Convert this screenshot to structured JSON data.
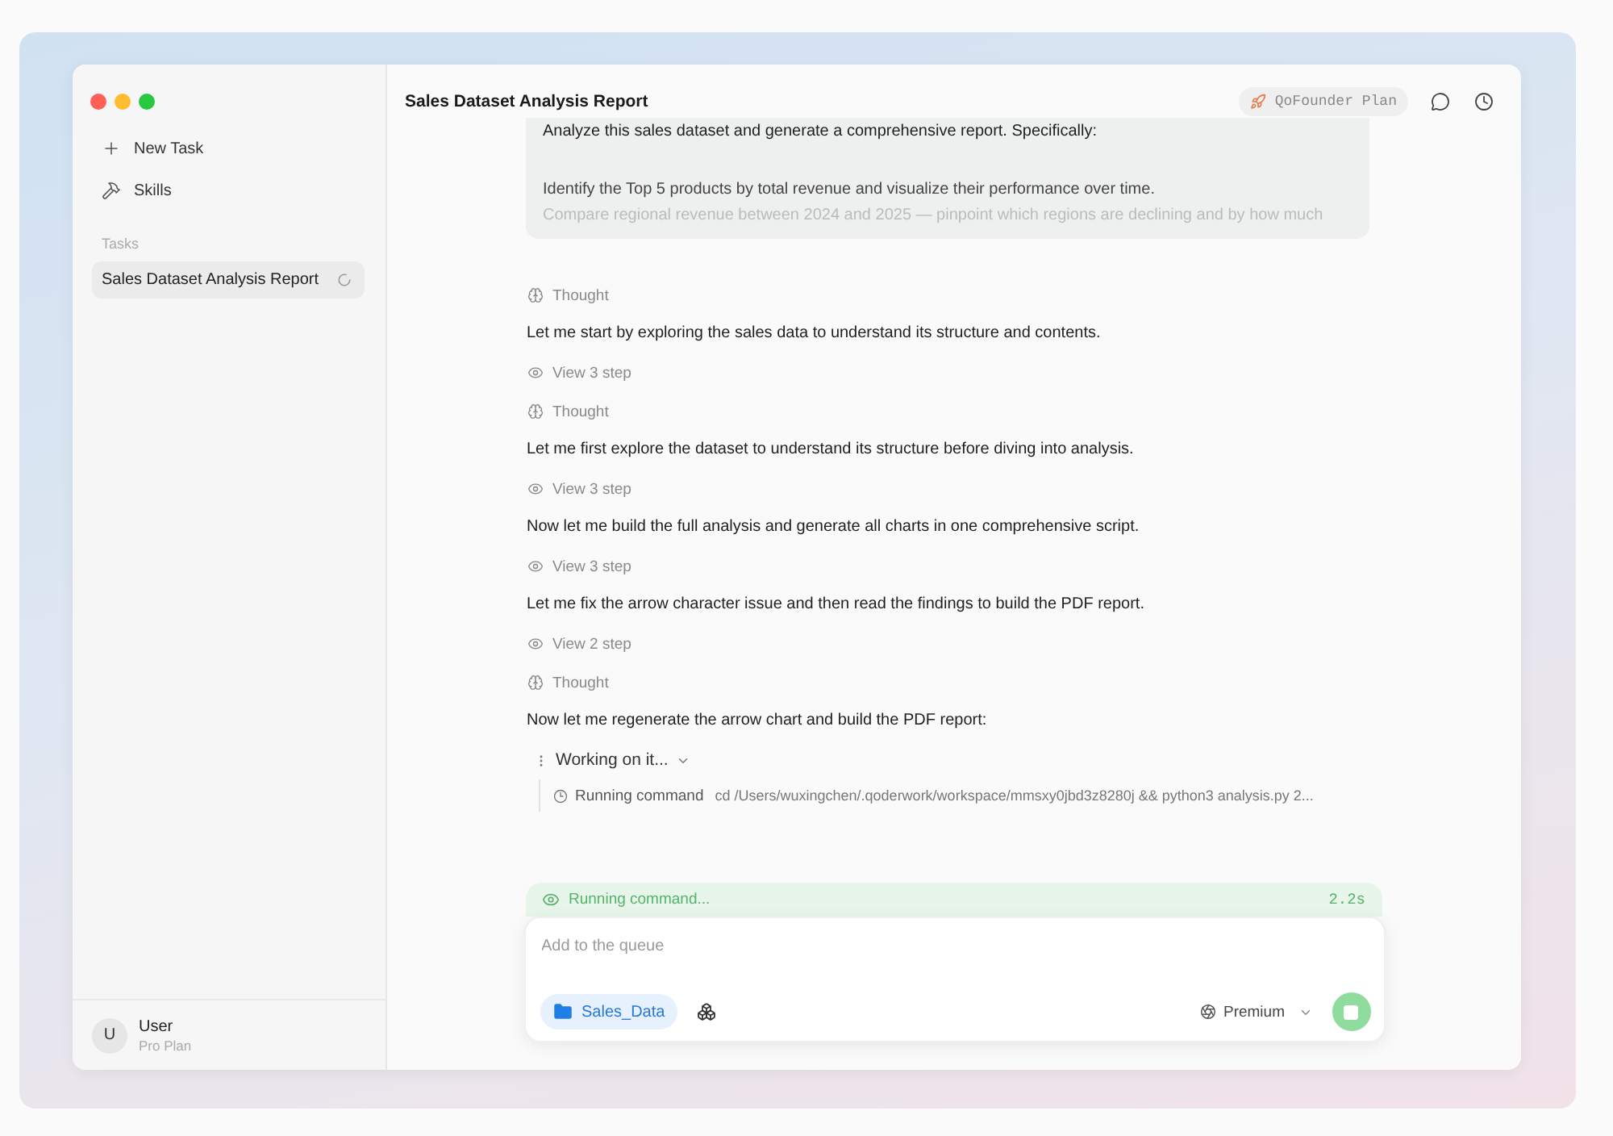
{
  "sidebar": {
    "actions": [
      {
        "kind": "new_task",
        "label": "New Task"
      },
      {
        "kind": "skills",
        "label": "Skills"
      }
    ],
    "section_label": "Tasks",
    "tasks": [
      {
        "title": "Sales Dataset Analysis Report",
        "selected": true,
        "running": true
      }
    ],
    "user": {
      "avatar_letter": "U",
      "name": "User",
      "plan": "Pro Plan"
    }
  },
  "header": {
    "title": "Sales Dataset Analysis Report",
    "plan_badge": "QoFounder Plan"
  },
  "prompt": {
    "paragraphs": [
      "Analyze this sales dataset and generate a comprehensive report. Specifically:",
      "Identify the Top 5 products by total revenue and visualize their performance over time.",
      "Compare regional revenue between 2024 and 2025 — pinpoint which regions are declining and by how much"
    ]
  },
  "timeline": [
    {
      "kind": "thought",
      "label": "Thought"
    },
    {
      "kind": "message",
      "text": "Let me start by exploring the sales data to understand its structure and contents."
    },
    {
      "kind": "steps",
      "label": "View 3 step"
    },
    {
      "kind": "thought",
      "label": "Thought"
    },
    {
      "kind": "message",
      "text": "Let me first explore the dataset to understand its structure before diving into analysis."
    },
    {
      "kind": "steps",
      "label": "View 3 step"
    },
    {
      "kind": "message",
      "text": "Now let me build the full analysis and generate all charts in one comprehensive script."
    },
    {
      "kind": "steps",
      "label": "View 3 step"
    },
    {
      "kind": "message",
      "text": "Let me fix the arrow character issue and then read the findings to build the PDF report."
    },
    {
      "kind": "steps",
      "label": "View 2 step"
    },
    {
      "kind": "thought",
      "label": "Thought"
    },
    {
      "kind": "message",
      "text": "Now let me regenerate the arrow chart and build the PDF report:"
    },
    {
      "kind": "working",
      "label": "Working on it...",
      "expanded": true,
      "children": [
        {
          "kind": "command",
          "label": "Running command",
          "command": "cd /Users/wuxingchen/.qoderwork/workspace/mmsxy0jbd3z8280j && python3 analysis.py 2..."
        }
      ]
    }
  ],
  "composer": {
    "status": {
      "label": "Running command...",
      "elapsed": "2.2s"
    },
    "placeholder": "Add to the queue",
    "folder_chip": "Sales_Data",
    "model": "Premium"
  }
}
